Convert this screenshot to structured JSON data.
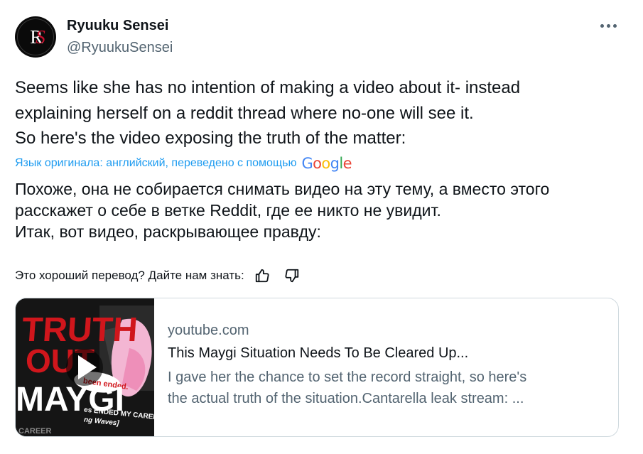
{
  "author": {
    "name": "Ryuuku Sensei",
    "handle": "@RyuukuSensei",
    "avatar_monogram": "RS"
  },
  "more_icon": "more-horizontal-icon",
  "tweet": {
    "lines": [
      "Seems like she has no intention of making a video about it- instead",
      "explaining herself on a reddit thread where no-one will see it.",
      "So here's the video exposing the truth of the matter:"
    ]
  },
  "translation": {
    "note": "Язык оригинала: английский, переведено с помощью",
    "provider": "Google",
    "lines": [
      "Похоже, она не собирается снимать видео на эту тему, а вместо этого",
      "расскажет о себе в ветке Reddit, где ее никто не увидит.",
      "Итак, вот видео, раскрывающее правду:"
    ],
    "feedback_question": "Это хороший перевод? Дайте нам знать:",
    "thumb_up_icon": "thumbs-up-icon",
    "thumb_down_icon": "thumbs-down-icon"
  },
  "link_card": {
    "domain": "youtube.com",
    "title": "This Maygi Situation Needs To Be Cleared Up...",
    "description_lines": [
      "I gave her the chance to set the record straight, so here's",
      "the actual truth of the situation.Cantarella leak stream: ..."
    ],
    "thumbnail": {
      "lines": [
        "TRUTH",
        "OUT",
        "MAYGI"
      ],
      "bubble": "been ended.",
      "caption_lines": [
        "es ENDED MY CAREER",
        "ng Waves]"
      ],
      "corner": "CAREER",
      "play_icon": "play-icon"
    }
  },
  "colors": {
    "text": "#0f1419",
    "secondary": "#536471",
    "link": "#1d9bf0",
    "border": "#cfd9de",
    "thumbnail_red": "#d0161c"
  }
}
